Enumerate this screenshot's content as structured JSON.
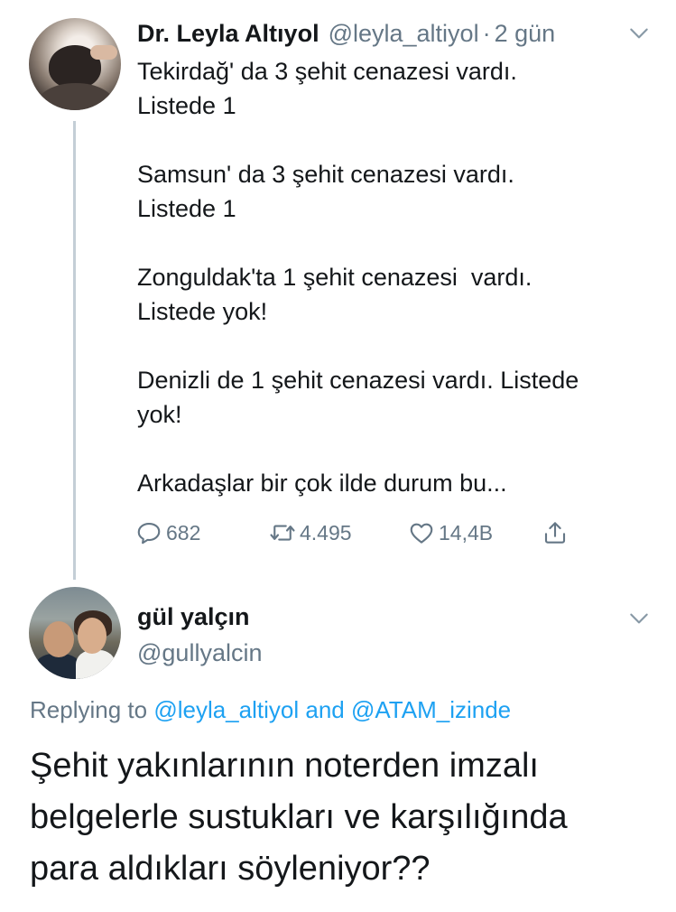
{
  "tweet1": {
    "author_name": "Dr. Leyla Altıyol",
    "handle": "@leyla_altiyol",
    "separator": "·",
    "time": "2 gün",
    "paragraphs": [
      [
        "Tekirdağ' da 3 şehit cenazesi vardı.",
        "Listede 1"
      ],
      [
        "Samsun' da 3 şehit cenazesi vardı.",
        "Listede 1"
      ],
      [
        "Zonguldak'ta 1 şehit cenazesi  vardı.",
        "Listede yok!"
      ],
      [
        "Denizli de 1 şehit cenazesi vardı. Listede",
        "yok!"
      ],
      [
        "Arkadaşlar bir çok ilde durum bu..."
      ]
    ],
    "actions": {
      "reply_count": "682",
      "retweet_count": "4.495",
      "like_count": "14,4B"
    },
    "icons": {
      "reply": "reply-icon",
      "retweet": "retweet-icon",
      "like": "heart-icon",
      "share": "share-icon",
      "menu": "chevron-down-icon"
    }
  },
  "tweet2": {
    "author_name": "gül yalçın",
    "handle": "@gullyalcin",
    "replying_prefix": "Replying to",
    "replying_mention_1": "@leyla_altiyol",
    "replying_and": "and",
    "replying_mention_2": "@ATAM_izinde",
    "text_lines": [
      "Şehit yakınlarının noterden imzalı",
      "belgelerle sustukları ve karşılığında",
      "para aldıkları söyleniyor??"
    ]
  },
  "colors": {
    "text": "#14171a",
    "secondary": "#657786",
    "link": "#1da1f2",
    "thread_line": "#c4ced6"
  }
}
